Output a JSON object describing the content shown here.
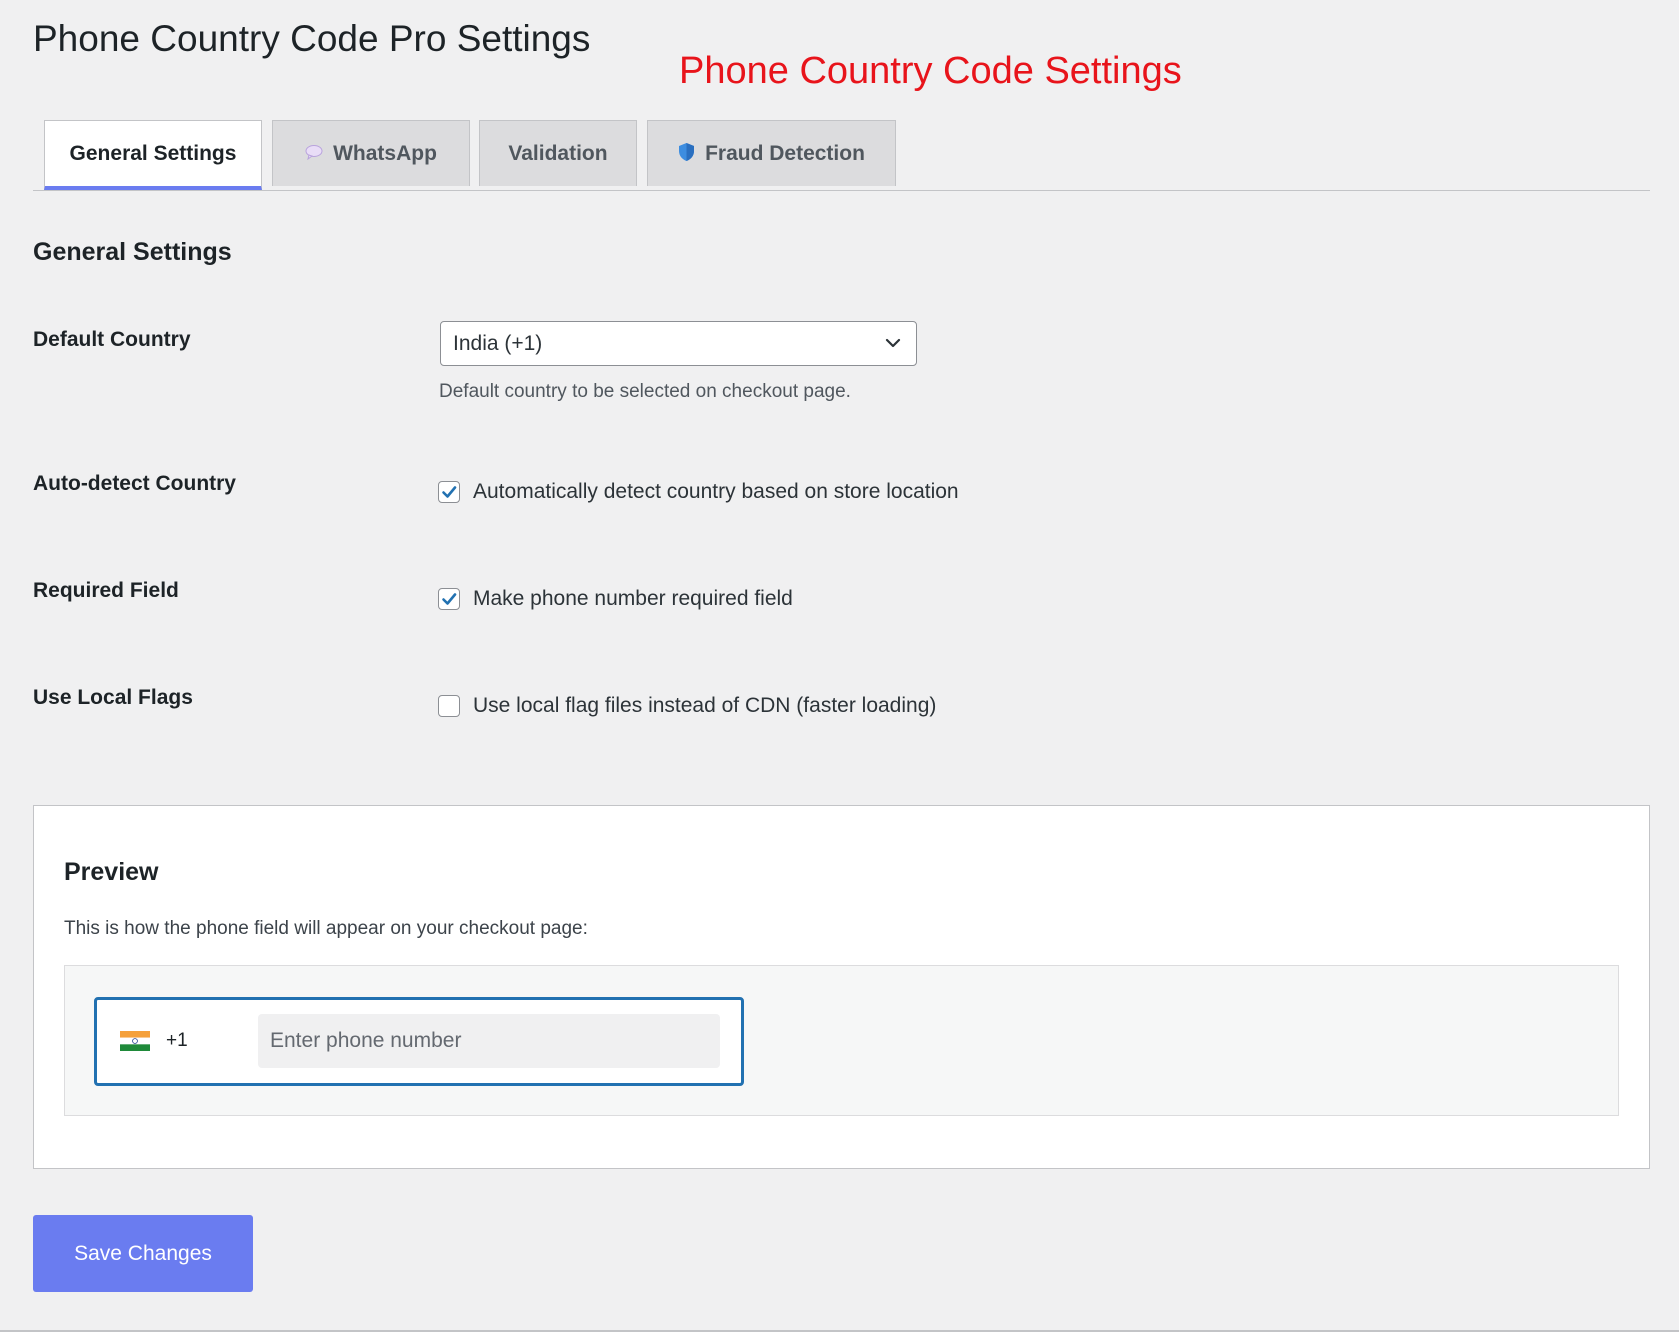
{
  "page": {
    "title": "Phone Country Code Pro Settings",
    "annotation": "Phone Country Code Settings"
  },
  "tabs": [
    {
      "label": "General Settings",
      "icon": "",
      "active": true
    },
    {
      "label": "WhatsApp",
      "icon": "speech-bubble-icon",
      "active": false
    },
    {
      "label": "Validation",
      "icon": "",
      "active": false
    },
    {
      "label": "Fraud Detection",
      "icon": "shield-icon",
      "active": false
    }
  ],
  "general": {
    "section_title": "General Settings",
    "default_country": {
      "label": "Default Country",
      "value": "India (+1)",
      "description": "Default country to be selected on checkout page."
    },
    "auto_detect": {
      "label": "Auto-detect Country",
      "checkbox_label": "Automatically detect country based on store location",
      "checked": true
    },
    "required_field": {
      "label": "Required Field",
      "checkbox_label": "Make phone number required field",
      "checked": true
    },
    "local_flags": {
      "label": "Use Local Flags",
      "checkbox_label": "Use local flag files instead of CDN (faster loading)",
      "checked": false
    }
  },
  "preview": {
    "title": "Preview",
    "description": "This is how the phone field will appear on your checkout page:",
    "flag_icon": "india-flag-icon",
    "dial_code": "+1",
    "phone_placeholder": "Enter phone number"
  },
  "actions": {
    "save_label": "Save Changes"
  },
  "colors": {
    "accent": "#6a7cf0",
    "annotation": "#e8141b",
    "focus_border": "#2271b1",
    "checkbox_check": "#2271b1"
  }
}
